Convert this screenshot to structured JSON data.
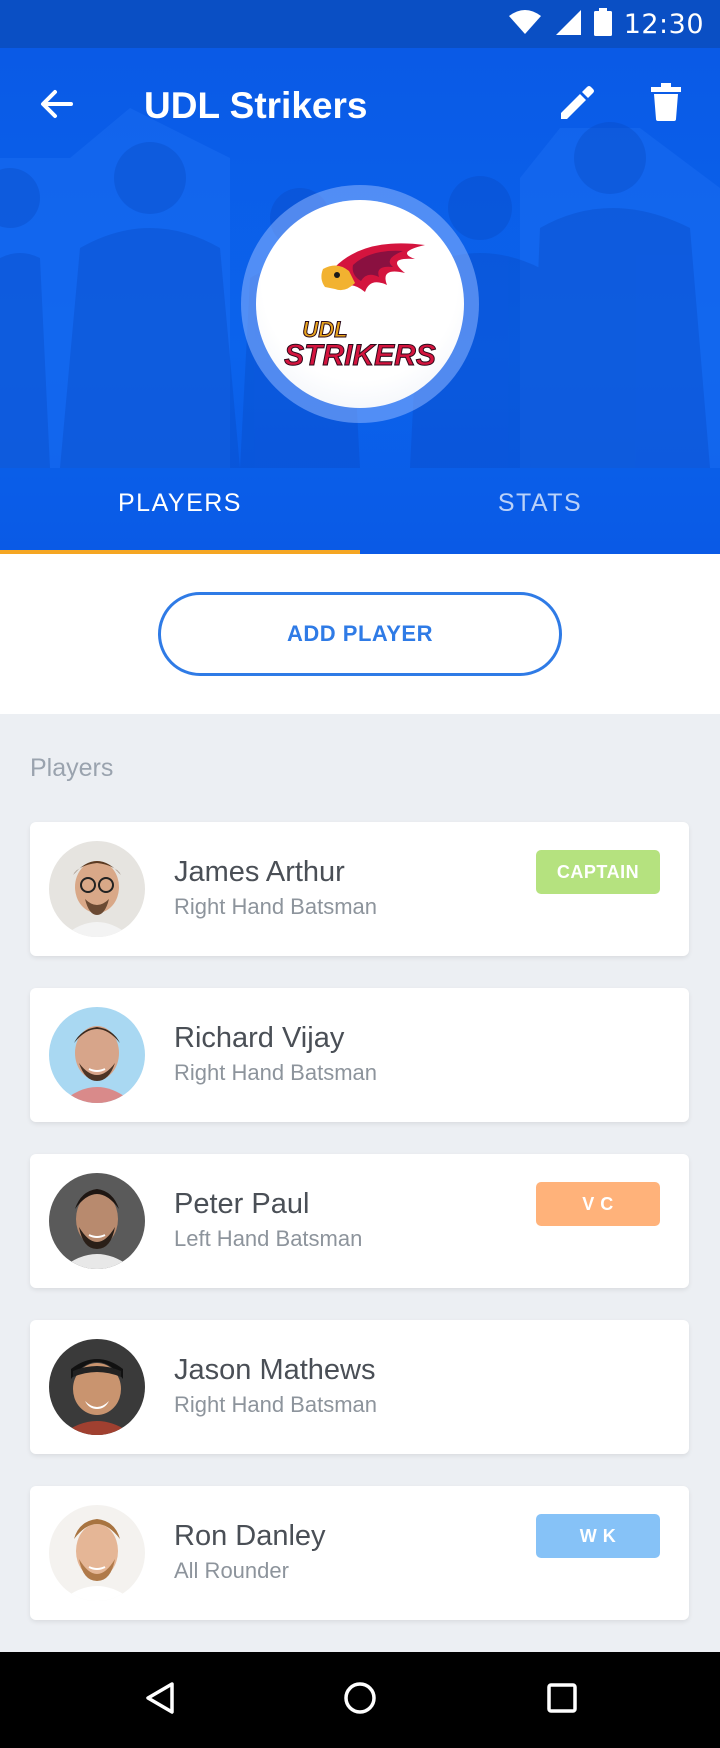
{
  "status_bar": {
    "time": "12:30",
    "icons": [
      "wifi-icon",
      "signal-icon",
      "battery-icon"
    ]
  },
  "app_bar": {
    "title": "UDL Strikers",
    "back_icon": "arrow-back-icon",
    "edit_icon": "pencil-icon",
    "delete_icon": "trash-icon"
  },
  "team_logo": {
    "line1": "UDL",
    "line2": "STRIKERS"
  },
  "tabs": [
    {
      "label": "PLAYERS",
      "active": true
    },
    {
      "label": "STATS",
      "active": false
    }
  ],
  "add_player_label": "ADD PLAYER",
  "players_section_label": "Players",
  "players": [
    {
      "name": "James Arthur",
      "role": "Right Hand Batsman",
      "badge": "CAPTAIN",
      "badge_color": "#b5e27f"
    },
    {
      "name": "Richard Vijay",
      "role": "Right Hand Batsman",
      "badge": null
    },
    {
      "name": "Peter Paul",
      "role": "Left Hand Batsman",
      "badge": "V C",
      "badge_color": "#ffb27a"
    },
    {
      "name": "Jason Mathews",
      "role": "Right Hand Batsman",
      "badge": null
    },
    {
      "name": "Ron Danley",
      "role": "All Rounder",
      "badge": "W K",
      "badge_color": "#86c2f7"
    }
  ],
  "colors": {
    "primary": "#0a5ae6",
    "accent": "#f5a623",
    "button_outline": "#2f7be6"
  },
  "nav_bar": {
    "icons": [
      "back-triangle-icon",
      "home-circle-icon",
      "recents-square-icon"
    ]
  }
}
